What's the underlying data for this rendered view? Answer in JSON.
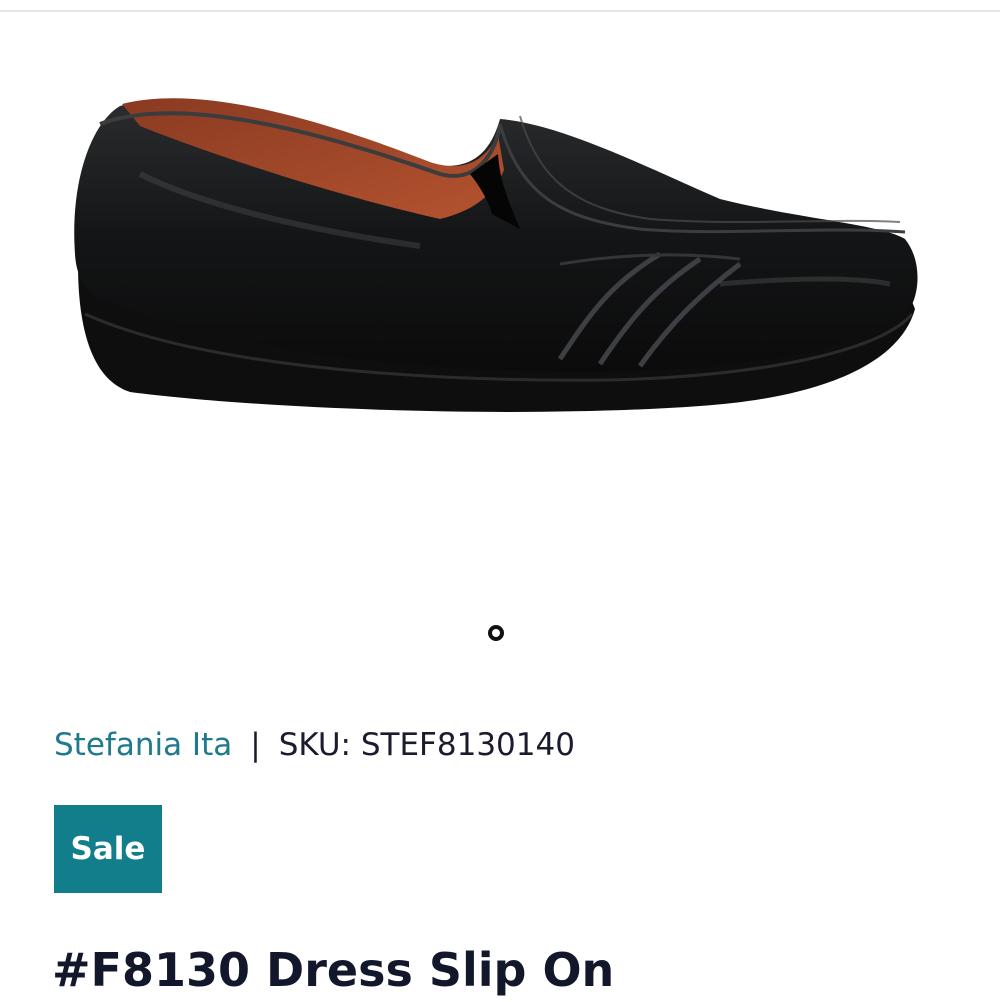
{
  "product": {
    "brand": "Stefania Ita",
    "separator": "|",
    "sku_label": "SKU:",
    "sku": "STEF8130140",
    "badge": "Sale",
    "title": "#F8130 Dress Slip On",
    "image_alt": "black leather slip-on shoe"
  },
  "gallery": {
    "image_count": 1,
    "active_index": 0
  },
  "colors": {
    "brand_link": "#1e7a8c",
    "badge_bg": "#127e8c",
    "title": "#13172b"
  }
}
